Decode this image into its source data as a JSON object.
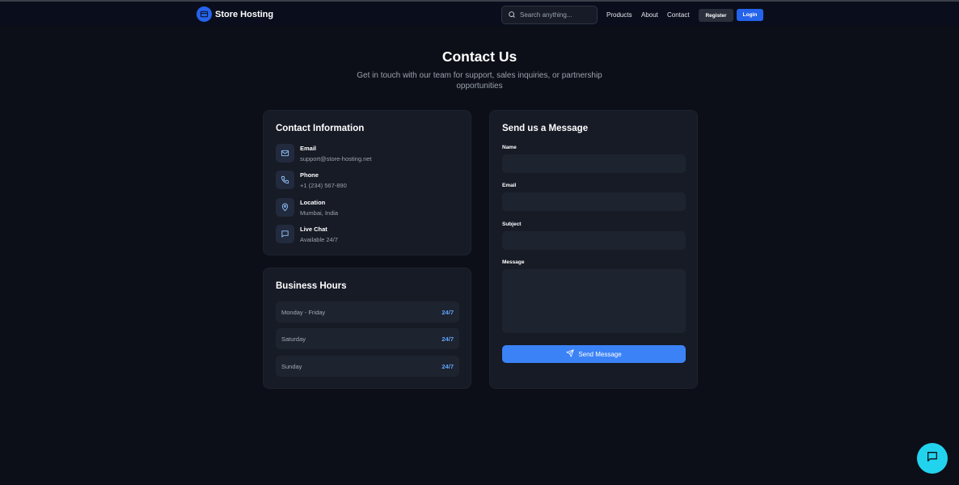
{
  "brand": {
    "name": "Store Hosting",
    "accent": "#2563eb"
  },
  "header": {
    "search_placeholder": "Search anything...",
    "nav": [
      "Products",
      "About",
      "Contact"
    ],
    "register_label": "Register",
    "login_label": "Login"
  },
  "hero": {
    "title": "Contact Us",
    "subtitle": "Get in touch with our team for support, sales inquiries, or partnership opportunities"
  },
  "contact_info": {
    "title": "Contact Information",
    "items": [
      {
        "icon": "mail-icon",
        "label": "Email",
        "value": "support@store-hosting.net"
      },
      {
        "icon": "phone-icon",
        "label": "Phone",
        "value": "+1 (234) 567-890"
      },
      {
        "icon": "map-pin-icon",
        "label": "Location",
        "value": "Mumbai, India"
      },
      {
        "icon": "chat-bubble-icon",
        "label": "Live Chat",
        "value": "Available 24/7"
      }
    ]
  },
  "business_hours": {
    "title": "Business Hours",
    "rows": [
      {
        "day": "Monday - Friday",
        "hours": "24/7"
      },
      {
        "day": "Saturday",
        "hours": "24/7"
      },
      {
        "day": "Sunday",
        "hours": "24/7"
      }
    ],
    "hours_color": "#60a5fa"
  },
  "message_form": {
    "title": "Send us a Message",
    "fields": [
      {
        "label": "Name",
        "value": "",
        "placeholder": ""
      },
      {
        "label": "Email",
        "value": "",
        "placeholder": ""
      },
      {
        "label": "Subject",
        "value": "",
        "placeholder": ""
      },
      {
        "label": "Message",
        "value": "",
        "placeholder": ""
      }
    ],
    "submit_label": "Send Message",
    "submit_color": "#3b82f6"
  },
  "chat_fab": {
    "icon": "chat-bubble-icon",
    "color": "#22d3ee"
  }
}
